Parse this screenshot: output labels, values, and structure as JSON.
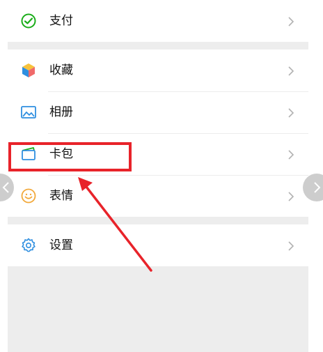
{
  "menu": {
    "items": [
      {
        "label": "支付",
        "icon": "wechat-pay-icon"
      },
      {
        "label": "收藏",
        "icon": "favorites-cube-icon"
      },
      {
        "label": "相册",
        "icon": "album-picture-icon"
      },
      {
        "label": "卡包",
        "icon": "card-wallet-icon"
      },
      {
        "label": "表情",
        "icon": "sticker-smile-icon"
      },
      {
        "label": "设置",
        "icon": "settings-gear-icon"
      }
    ]
  },
  "colors": {
    "highlight": "#e8232a",
    "background": "#ededed",
    "pay_green": "#1aad19",
    "icon_blue": "#2f8fe0"
  }
}
